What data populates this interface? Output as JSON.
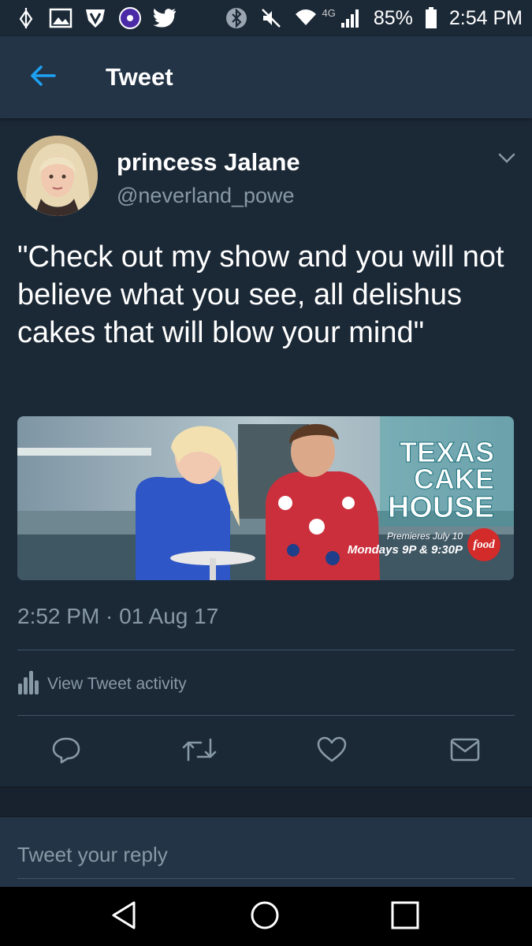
{
  "status_bar": {
    "network": "4G",
    "battery": "85%",
    "time": "2:54 PM",
    "left_icons": [
      "tor-icon",
      "gallery-icon",
      "vpn-shield-icon",
      "app-icon",
      "twitter-bird-icon"
    ],
    "right_icons": [
      "bluetooth-icon",
      "mute-icon",
      "wifi-icon",
      "signal-icon",
      "battery-icon"
    ]
  },
  "app_bar": {
    "title": "Tweet",
    "back_icon": "back-arrow-icon"
  },
  "tweet": {
    "display_name": "princess Jalane",
    "handle": "@neverland_powe",
    "text": "\"Check out my show and you will not believe what you see, all delishus cakes that will blow your mind\"",
    "timestamp": "2:52 PM · 01 Aug 17",
    "media": {
      "title_line1": "TEXAS",
      "title_line2": "CAKE",
      "title_line3": "HOUSE",
      "premieres": "Premieres July 10",
      "schedule": "Mondays 9P & 9:30P",
      "network": "food"
    },
    "activity_label": "View Tweet activity"
  },
  "actions": [
    "reply-icon",
    "retweet-icon",
    "like-icon",
    "dm-icon"
  ],
  "reply": {
    "placeholder": "Tweet your reply"
  },
  "colors": {
    "background": "#1b2836",
    "app_bar": "#243447",
    "accent": "#1da1f2",
    "secondary_text": "#8899a6"
  }
}
